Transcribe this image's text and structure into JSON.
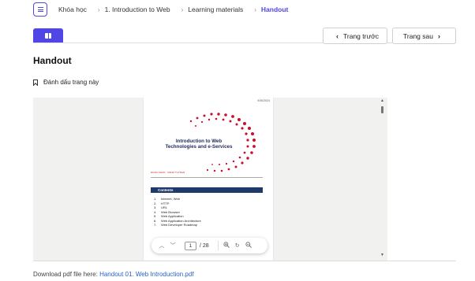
{
  "breadcrumb": {
    "items": [
      "Khóa học",
      "1. Introduction to Web",
      "Learning materials",
      "Handout"
    ]
  },
  "nav": {
    "prev_label": "Trang trước",
    "next_label": "Trang sau"
  },
  "page_title": "Handout",
  "bookmark_label": "Đánh dấu trang này",
  "pdf": {
    "date": "9/30/2024",
    "title": "Introduction to Web Technologies and e-Services",
    "authors": "DUNG NGOC · DANG TUYNAN",
    "contents_heading": "Contents",
    "toc": [
      {
        "num": "1.",
        "text": "Internet, Web"
      },
      {
        "num": "2.",
        "text": "HTTP"
      },
      {
        "num": "3.",
        "text": "URL"
      },
      {
        "num": "4.",
        "text": "Web Browser"
      },
      {
        "num": "5.",
        "text": "Web Application"
      },
      {
        "num": "6.",
        "text": "Web Application Architecture"
      },
      {
        "num": "7.",
        "text": "Web Developer Roadmap"
      }
    ],
    "current_page": "1",
    "total_pages": "/ 28"
  },
  "download": {
    "prefix": "Download pdf file here: ",
    "link_text": "Handout 01. Web Introduction.pdf"
  },
  "colors": {
    "accent": "#4f46e5",
    "link": "#2563c9",
    "pdf_swirl": "#c8102e"
  },
  "icons": {
    "menu": "menu-icon",
    "tab": "book-icon",
    "bookmark": "bookmark-icon",
    "zoom_in": "zoom-in-icon",
    "zoom_out": "zoom-out-icon",
    "rotate": "rotate-icon"
  }
}
